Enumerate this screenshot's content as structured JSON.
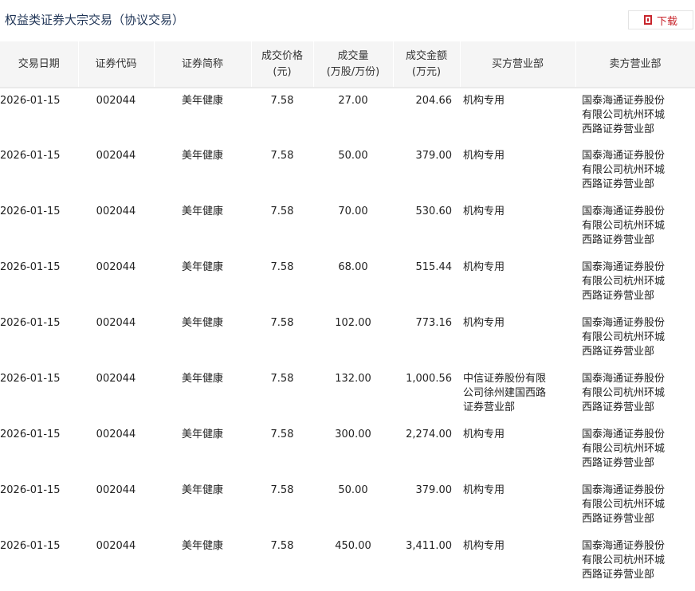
{
  "title": "权益类证券大宗交易（协议交易）",
  "download_label": "下载",
  "headers": [
    [
      "交易日期",
      ""
    ],
    [
      "证券代码",
      ""
    ],
    [
      "证券简称",
      ""
    ],
    [
      "成交价格",
      "(元)"
    ],
    [
      "成交量",
      "(万股/万份)"
    ],
    [
      "成交金额",
      "(万元)"
    ],
    [
      "买方营业部",
      ""
    ],
    [
      "卖方营业部",
      ""
    ]
  ],
  "rows": [
    [
      "2026-01-15",
      "002044",
      "美年健康",
      "7.58",
      "27.00",
      "204.66",
      "机构专用",
      "国泰海通证券股份有限公司杭州环城西路证券营业部"
    ],
    [
      "2026-01-15",
      "002044",
      "美年健康",
      "7.58",
      "50.00",
      "379.00",
      "机构专用",
      "国泰海通证券股份有限公司杭州环城西路证券营业部"
    ],
    [
      "2026-01-15",
      "002044",
      "美年健康",
      "7.58",
      "70.00",
      "530.60",
      "机构专用",
      "国泰海通证券股份有限公司杭州环城西路证券营业部"
    ],
    [
      "2026-01-15",
      "002044",
      "美年健康",
      "7.58",
      "68.00",
      "515.44",
      "机构专用",
      "国泰海通证券股份有限公司杭州环城西路证券营业部"
    ],
    [
      "2026-01-15",
      "002044",
      "美年健康",
      "7.58",
      "102.00",
      "773.16",
      "机构专用",
      "国泰海通证券股份有限公司杭州环城西路证券营业部"
    ],
    [
      "2026-01-15",
      "002044",
      "美年健康",
      "7.58",
      "132.00",
      "1,000.56",
      "中信证券股份有限公司徐州建国西路证券营业部",
      "国泰海通证券股份有限公司杭州环城西路证券营业部"
    ],
    [
      "2026-01-15",
      "002044",
      "美年健康",
      "7.58",
      "300.00",
      "2,274.00",
      "机构专用",
      "国泰海通证券股份有限公司杭州环城西路证券营业部"
    ],
    [
      "2026-01-15",
      "002044",
      "美年健康",
      "7.58",
      "50.00",
      "379.00",
      "机构专用",
      "国泰海通证券股份有限公司杭州环城西路证券营业部"
    ],
    [
      "2026-01-15",
      "002044",
      "美年健康",
      "7.58",
      "450.00",
      "3,411.00",
      "机构专用",
      "国泰海通证券股份有限公司杭州环城西路证券营业部"
    ]
  ]
}
